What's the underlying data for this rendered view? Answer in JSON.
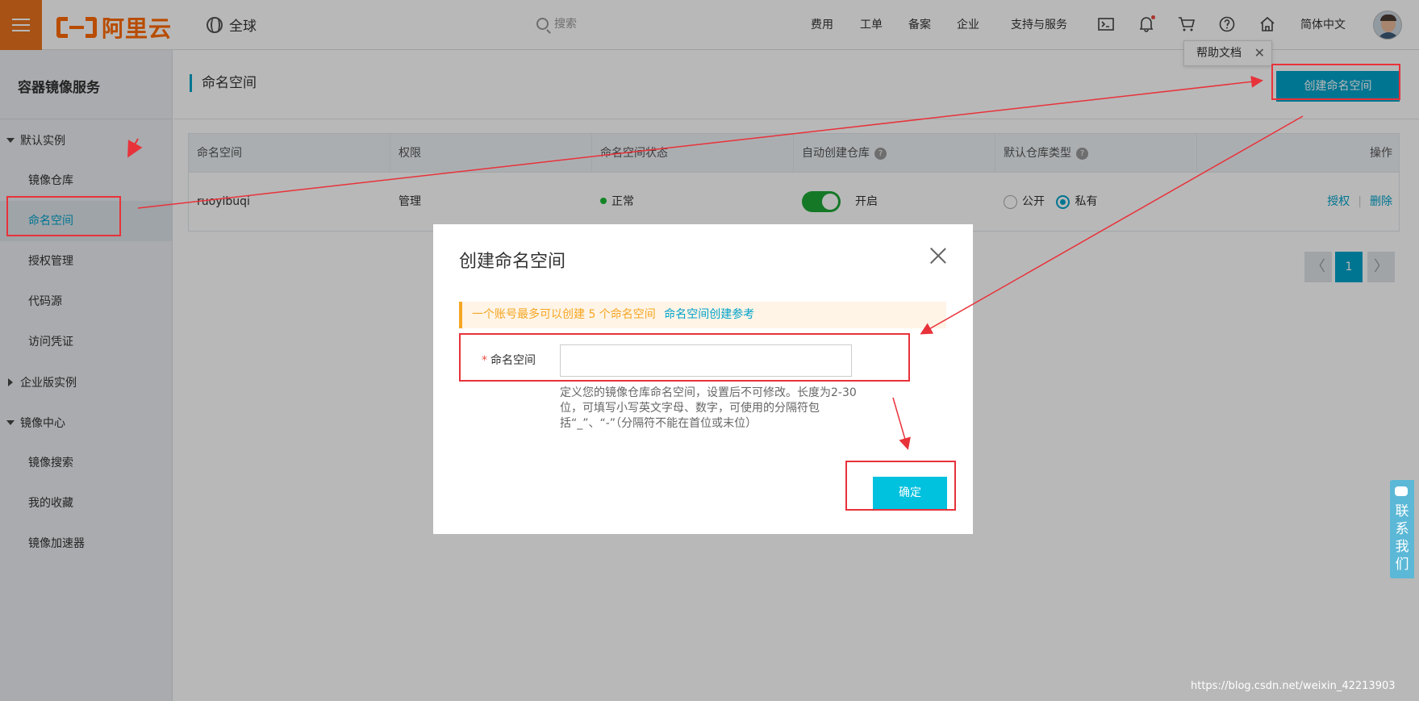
{
  "header": {
    "logo_text": "阿里云",
    "region": "全球",
    "search_placeholder": "搜索",
    "nav": [
      "费用",
      "工单",
      "备案",
      "企业",
      "支持与服务"
    ],
    "language": "简体中文"
  },
  "sidebar": {
    "title": "容器镜像服务",
    "groups": [
      {
        "label": "默认实例",
        "items": [
          "镜像仓库",
          "命名空间",
          "授权管理",
          "代码源",
          "访问凭证"
        ]
      },
      {
        "label": "企业版实例"
      },
      {
        "label": "镜像中心",
        "items": [
          "镜像搜索",
          "我的收藏",
          "镜像加速器"
        ]
      }
    ],
    "active_item": "命名空间"
  },
  "page": {
    "title": "命名空间",
    "create_button": "创建命名空间",
    "help_tip": "帮助文档",
    "help_close": "✕"
  },
  "table": {
    "columns": [
      "命名空间",
      "权限",
      "命名空间状态",
      "自动创建仓库",
      "默认仓库类型",
      "操作"
    ],
    "help_icon": "?",
    "rows": [
      {
        "namespace": "ruoyibuqi",
        "permission": "管理",
        "status": "正常",
        "auto_create": "开启",
        "repo_type_public": "公开",
        "repo_type_private": "私有",
        "repo_type_selected": "私有",
        "actions": [
          "授权",
          "删除"
        ],
        "action_separator": "|"
      }
    ]
  },
  "pagination": {
    "prev": "〈",
    "current": "1",
    "next": "〉"
  },
  "dialog": {
    "title": "创建命名空间",
    "notice_text": "一个账号最多可以创建 5 个命名空间",
    "notice_link": "命名空间创建参考",
    "field_required": "*",
    "field_label": "命名空间",
    "field_value": "",
    "help_text": "定义您的镜像仓库命名空间，设置后不可修改。长度为2-30位，可填写小写英文字母、数字，可使用的分隔符包括“_”、“-”（分隔符不能在首位或末位）",
    "confirm_button": "确定"
  },
  "contact": "联系我们",
  "watermark": "https://blog.csdn.net/weixin_42213903",
  "colors": {
    "accent": "#00a2ca",
    "brand": "#ff6a00",
    "highlight": "#e8323a",
    "confirm": "#00c1de"
  }
}
